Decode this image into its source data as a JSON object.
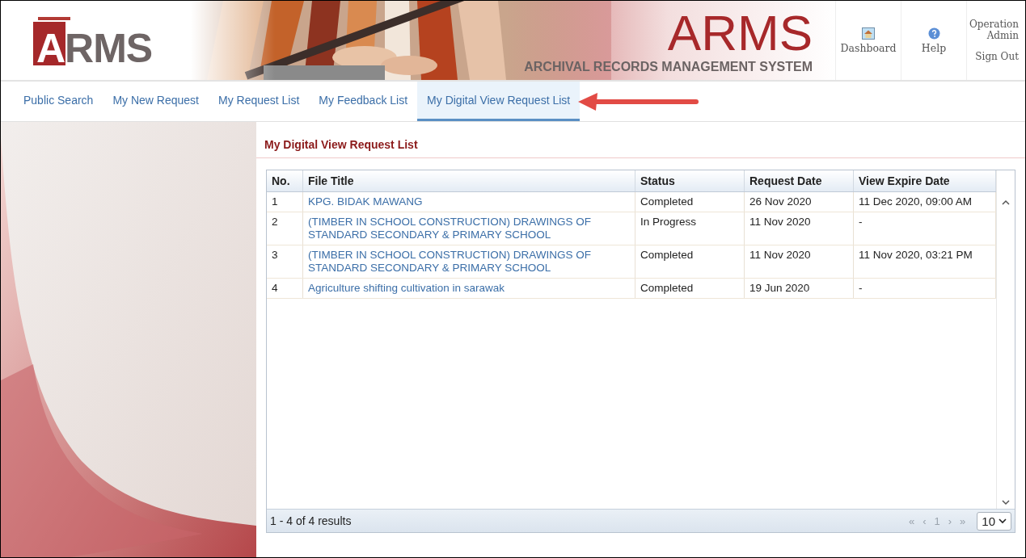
{
  "header": {
    "logo_text": "ARMS",
    "title": "ARMS",
    "subtitle": "ARCHIVAL RECORDS MANAGEMENT SYSTEM",
    "actions": [
      {
        "kind": "dashboard",
        "label": "Dashboard"
      },
      {
        "kind": "help",
        "label": "Help"
      }
    ],
    "user": {
      "name": "Operation Admin",
      "sign_out": "Sign Out"
    }
  },
  "nav": [
    {
      "label": "Public Search",
      "selected": false
    },
    {
      "label": "My New Request",
      "selected": false
    },
    {
      "label": "My Request List",
      "selected": false
    },
    {
      "label": "My Feedback List",
      "selected": false
    },
    {
      "label": "My Digital View Request List",
      "selected": true
    }
  ],
  "panel_title": "My Digital View Request List",
  "table": {
    "columns": [
      "No.",
      "File Title",
      "Status",
      "Request Date",
      "View Expire Date"
    ],
    "rows": [
      [
        "1",
        "KPG. BIDAK MAWANG",
        "Completed",
        "26 Nov 2020",
        "11 Dec 2020, 09:00 AM"
      ],
      [
        "2",
        "(TIMBER IN SCHOOL CONSTRUCTION) DRAWINGS OF STANDARD SECONDARY & PRIMARY SCHOOL",
        "In Progress",
        "11 Nov 2020",
        "-"
      ],
      [
        "3",
        "(TIMBER IN SCHOOL CONSTRUCTION) DRAWINGS OF STANDARD SECONDARY & PRIMARY SCHOOL",
        "Completed",
        "11 Nov 2020",
        "11 Nov 2020, 03:21 PM"
      ],
      [
        "4",
        "Agriculture shifting cultivation in sarawak",
        "Completed",
        "19 Jun 2020",
        "-"
      ]
    ]
  },
  "pager": {
    "summary": "1 - 4 of 4 results",
    "first": "«",
    "prev": "‹",
    "page": "1",
    "next": "›",
    "last": "»",
    "page_size": "10"
  }
}
